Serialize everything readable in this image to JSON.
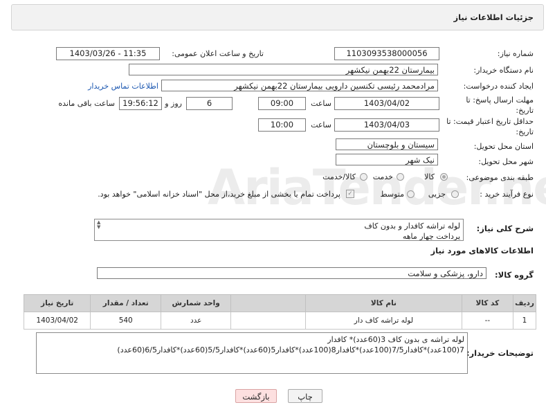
{
  "header": {
    "title": "جزئیات اطلاعات نیاز"
  },
  "watermark": "AriaTender.neT",
  "fields": {
    "need_number_label": "شماره نیاز:",
    "need_number": "1103093538000056",
    "announce_label": "تاریخ و ساعت اعلان عمومی:",
    "announce_value": "1403/03/26 - 11:35",
    "buyer_label": "نام دستگاه خریدار:",
    "buyer_value": "بیمارستان 22بهمن نیکشهر",
    "creator_label": "ایجاد کننده درخواست:",
    "creator_value": "مرادمحمد رئیسی تکنسین دارویی بیمارستان 22بهمن نیکشهر",
    "contact_link": "اطلاعات تماس خریدار",
    "deadline_label": "مهلت ارسال پاسخ: تا تاریخ:",
    "deadline_date": "1403/04/02",
    "time_label": "ساعت",
    "deadline_time": "09:00",
    "days_value": "6",
    "days_label": "روز و",
    "remaining_time": "19:56:12",
    "remaining_label": "ساعت باقی مانده",
    "validity_label": "حداقل تاریخ اعتبار قیمت: تا تاریخ:",
    "validity_date": "1403/04/03",
    "validity_time": "10:00",
    "province_label": "استان محل تحویل:",
    "province_value": "سیستان و بلوچستان",
    "city_label": "شهر محل تحویل:",
    "city_value": "نیک شهر",
    "category_label": "طبقه بندی موضوعی:",
    "category_options": [
      "کالا",
      "خدمت",
      "کالا/خدمت"
    ],
    "process_label": "نوع فرآیند خرید :",
    "process_options": [
      "جزیی",
      "متوسط"
    ],
    "payment_note": "پرداخت تمام یا بخشی از مبلغ خرید،از محل \"اسناد خزانه اسلامی\" خواهد بود."
  },
  "description": {
    "label": "شرح کلی نیاز:",
    "lines": [
      "لوله تراشه کافدار و بدون کاف",
      "پرداخت چهار ماهه"
    ]
  },
  "goods_info_title": "اطلاعات کالاهای مورد نیاز",
  "goods_group": {
    "label": "گروه کالا:",
    "value": "دارو، پزشکی و سلامت"
  },
  "table": {
    "headers": [
      "ردیف",
      "کد کالا",
      "نام کالا",
      "واحد شمارش",
      "تعداد / مقدار",
      "تاریخ نیاز"
    ],
    "rows": [
      [
        "1",
        "--",
        "لوله تراشه کاف دار",
        "عدد",
        "540",
        "1403/04/02"
      ]
    ]
  },
  "buyer_notes": {
    "label": "توضیحات خریدار:",
    "lines": [
      "لوله تراشه ی بدون کاف 3(60عدد)* کافدار",
      "7(100عدد)*کافدار7/5(100عدد)*کافدار8(100عدد)*کافدار5(60عدد)*کافدار5/5(60عدد)*کافدار6/5(60عدد)"
    ]
  },
  "buttons": {
    "print": "چاپ",
    "back": "بازگشت"
  }
}
